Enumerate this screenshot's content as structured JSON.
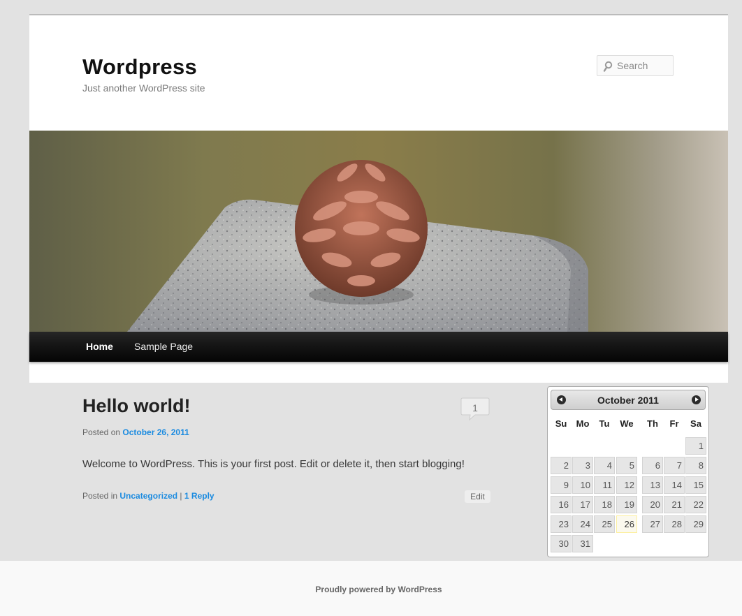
{
  "site": {
    "title": "Wordpress",
    "description": "Just another WordPress site"
  },
  "search": {
    "placeholder": "Search"
  },
  "nav": {
    "items": [
      "Home",
      "Sample Page"
    ],
    "current": "Home"
  },
  "post": {
    "title": "Hello world!",
    "comment_count": "1",
    "posted_on_label": "Posted on",
    "date": "October 26, 2011",
    "content": "Welcome to WordPress. This is your first post. Edit or delete it, then start blogging!",
    "posted_in_label": "Posted in",
    "category": "Uncategorized",
    "separator": "|",
    "reply_link": "1 Reply",
    "edit_label": "Edit"
  },
  "calendar": {
    "title": "October 2011",
    "weekdays": [
      "Su",
      "Mo",
      "Tu",
      "We",
      "Th",
      "Fr",
      "Sa"
    ],
    "first_weekday_index": 6,
    "days_in_month": 31,
    "today": 26
  },
  "footer": {
    "text": "Proudly powered by WordPress"
  },
  "colors": {
    "link": "#1b8be0",
    "nav_bg": "#111111",
    "page_bg": "#e2e2e2"
  }
}
